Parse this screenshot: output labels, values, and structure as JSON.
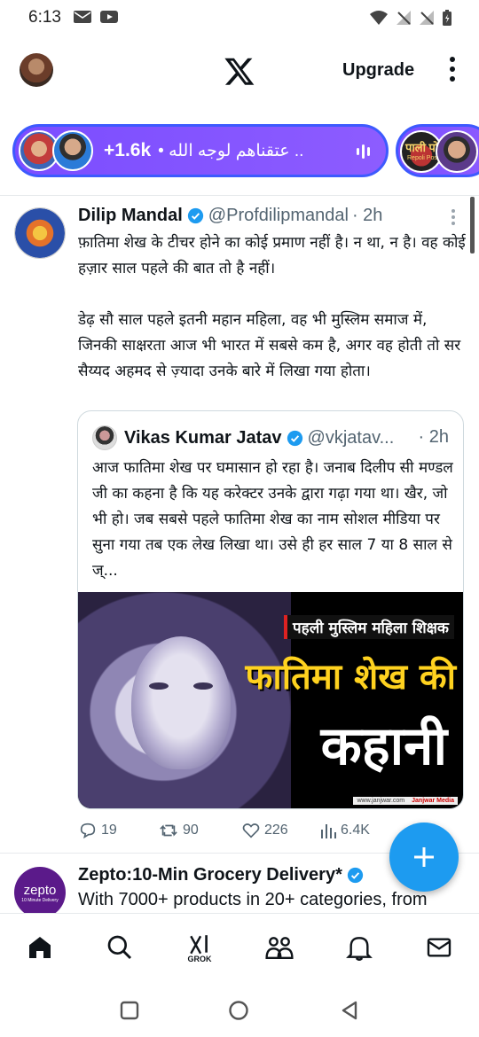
{
  "status_bar": {
    "time": "6:13",
    "left_icons": [
      "mail-icon",
      "youtube-icon"
    ],
    "right_icons": [
      "wifi-icon",
      "no-signal-icon",
      "no-signal-icon",
      "battery-icon"
    ]
  },
  "top_nav": {
    "logo": "x-logo",
    "upgrade_label": "Upgrade"
  },
  "spaces": {
    "count_label": "+1.6k",
    "title": "• عتقناهم لوجه الله ..",
    "second_pill_text": "पाली पो",
    "second_pill_subtext": "Repoli Post",
    "accent_color": "#7b4dff"
  },
  "tweet": {
    "author_name": "Dilip Mandal",
    "handle": "@Profdilipmandal",
    "time": "· 2h",
    "text": "फ़ातिमा शेख के टीचर होने का कोई प्रमाण नहीं है। न था, न है। वह कोई हज़ार साल पहले की बात तो है नहीं।\n\nडेढ़ सौ साल पहले इतनी महान महिला, वह भी मुस्लिम समाज में, जिनकी साक्षरता आज भी भारत में सबसे कम है, अगर वह होती तो सर सैय्यद अहमद से ज़्यादा उनके बारे में लिखा गया होता।",
    "quote": {
      "author_name": "Vikas Kumar Jatav",
      "handle": "@vkjatav...",
      "time": "· 2h",
      "text": "आज फातिमा शेख पर घमासान हो रहा है। जनाब दिलीप सी मण्डल जी का कहना है कि यह करेक्टर उनके द्वारा गढ़ा गया था। खैर, जो भी हो। जब सबसे पहले फातिमा शेख का नाम सोशल मीडिया पर सुना गया तब एक लेख लिखा था। उसे ही हर साल 7 या 8 साल से ज्...",
      "image": {
        "banner_text": "पहली मुस्लिम महिला शिक्षक",
        "headline_yellow": "फातिमा शेख की",
        "headline_white": "कहानी",
        "footer_site": "www.janjwar.com",
        "footer_brand": "Janjwar Media"
      }
    },
    "actions": {
      "replies": "19",
      "reposts": "90",
      "likes": "226",
      "views": "6.4K"
    }
  },
  "ad_tweet": {
    "avatar_text": "zepto",
    "avatar_subtext": "10 Minute Delivery",
    "name": "Zepto:10-Min Grocery Delivery*",
    "text": "With 7000+ products in 20+ categories, from"
  },
  "bottom_nav": {
    "items": [
      "home-icon",
      "search-icon",
      "grok-icon",
      "communities-icon",
      "notifications-icon",
      "messages-icon"
    ],
    "grok_label": "GROK"
  },
  "android_nav": [
    "recents-button",
    "home-button",
    "back-button"
  ],
  "colors": {
    "brand_blue": "#1d9bf0",
    "secondary_text": "#536471",
    "spaces_purple": "#7b4dff"
  }
}
